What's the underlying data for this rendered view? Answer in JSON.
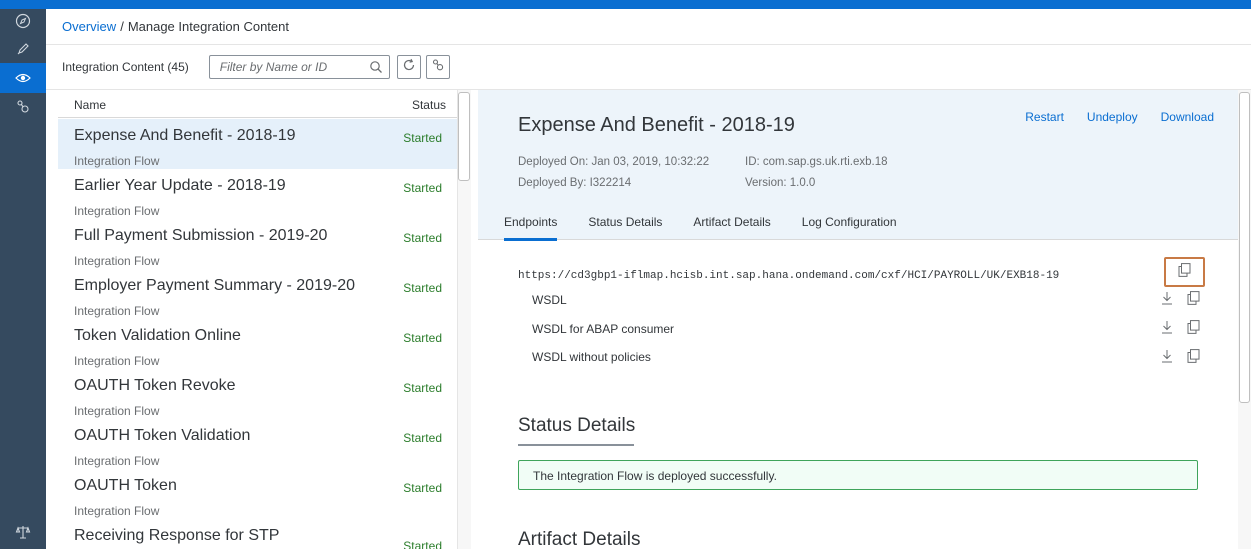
{
  "breadcrumb": {
    "link": "Overview",
    "separator": "/",
    "current": "Manage Integration Content"
  },
  "toolbar": {
    "count_label": "Integration Content (45)",
    "search_placeholder": "Filter by Name or ID",
    "search_value": ""
  },
  "list": {
    "header_name": "Name",
    "header_status": "Status",
    "items": [
      {
        "title": "Expense And Benefit - 2018-19",
        "subtitle": "Integration Flow",
        "status": "Started",
        "selected": true
      },
      {
        "title": "Earlier Year Update - 2018-19",
        "subtitle": "Integration Flow",
        "status": "Started"
      },
      {
        "title": "Full Payment Submission - 2019-20",
        "subtitle": "Integration Flow",
        "status": "Started"
      },
      {
        "title": "Employer Payment Summary - 2019-20",
        "subtitle": "Integration Flow",
        "status": "Started"
      },
      {
        "title": "Token Validation Online",
        "subtitle": "Integration Flow",
        "status": "Started"
      },
      {
        "title": "OAUTH Token Revoke",
        "subtitle": "Integration Flow",
        "status": "Started"
      },
      {
        "title": "OAUTH Token Validation",
        "subtitle": "Integration Flow",
        "status": "Started"
      },
      {
        "title": "OAUTH Token",
        "subtitle": "Integration Flow",
        "status": "Started"
      },
      {
        "title": "Receiving Response for STP",
        "subtitle": "",
        "status": "Started"
      }
    ]
  },
  "detail": {
    "title": "Expense And Benefit - 2018-19",
    "actions": {
      "restart": "Restart",
      "undeploy": "Undeploy",
      "download": "Download"
    },
    "deployed_on": "Deployed On: Jan 03, 2019, 10:32:22",
    "id": "ID: com.sap.gs.uk.rti.exb.18",
    "deployed_by": "Deployed By: I322214",
    "version": "Version: 1.0.0",
    "tabs": [
      "Endpoints",
      "Status Details",
      "Artifact Details",
      "Log Configuration"
    ],
    "endpoint_url": "https://cd3gbp1-iflmap.hcisb.int.sap.hana.ondemand.com/cxf/HCI/PAYROLL/UK/EXB18-19",
    "wsdl_rows": [
      "WSDL",
      "WSDL for ABAP consumer",
      "WSDL without policies"
    ],
    "status_section_title": "Status Details",
    "status_message": "The Integration Flow is deployed successfully.",
    "artifact_section_title": "Artifact Details"
  },
  "icons": {
    "nav": [
      "compass-icon",
      "pencil-icon",
      "eye-icon",
      "settings-nodes-icon",
      "balance-icon"
    ],
    "search": "search-icon",
    "refresh": "refresh-icon",
    "settings": "settings-icon",
    "copy": "copy-icon",
    "download": "download-icon"
  },
  "colors": {
    "brand": "#0a6ed1",
    "nav_bg": "#354a5f",
    "success": "#2b7d2b",
    "highlight": "#c87a45"
  }
}
